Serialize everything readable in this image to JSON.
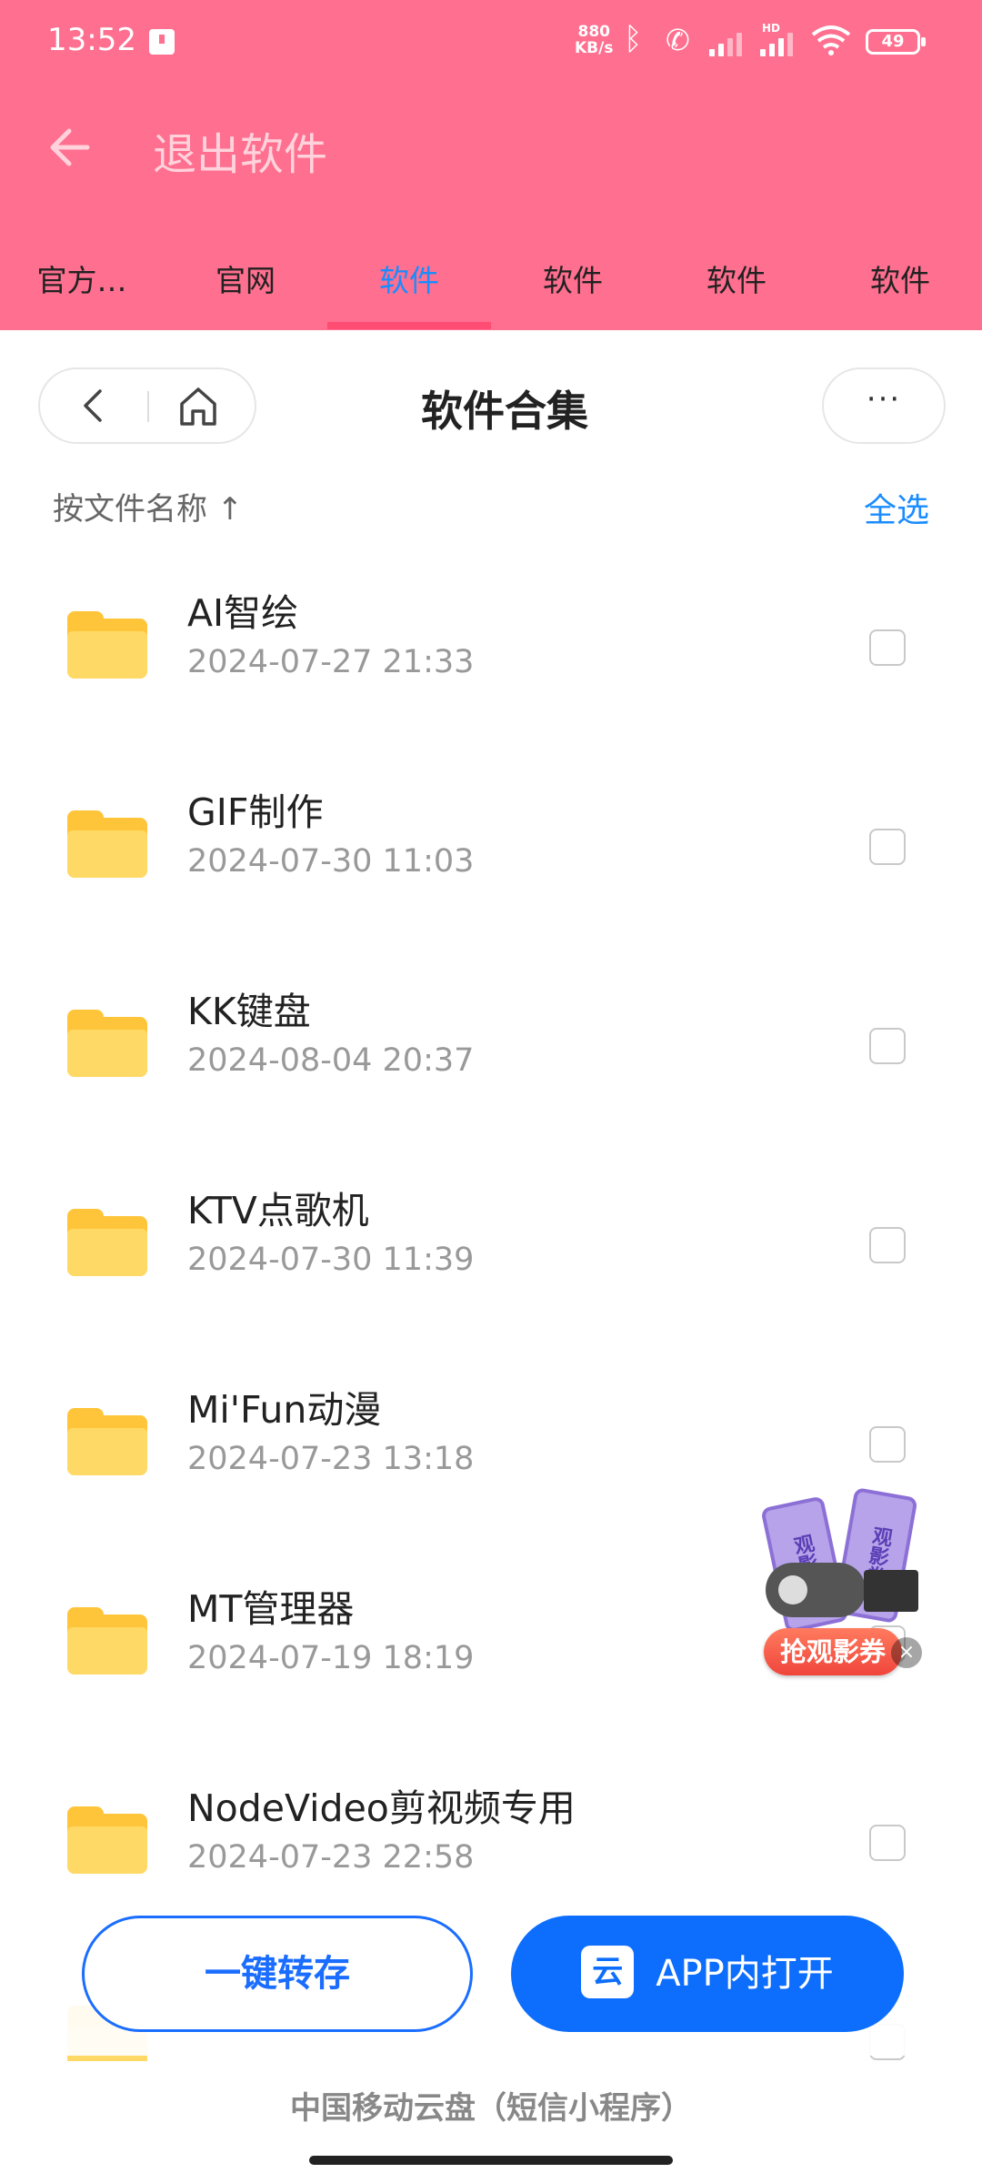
{
  "status_bar": {
    "time": "13:52",
    "speed_value": "880",
    "speed_unit": "KB/s",
    "signal_hd": "HD",
    "battery": "49"
  },
  "header": {
    "title": "退出软件",
    "tabs": [
      {
        "label": "官方…",
        "active": false
      },
      {
        "label": "官网",
        "active": false
      },
      {
        "label": "软件",
        "active": true
      },
      {
        "label": "软件",
        "active": false
      },
      {
        "label": "软件",
        "active": false
      },
      {
        "label": "软件",
        "active": false
      }
    ]
  },
  "toolbar": {
    "folder_title": "软件合集",
    "more_label": "···",
    "sort_label": "按文件名称 ↑",
    "select_all": "全选"
  },
  "files": [
    {
      "name": "AI智绘",
      "date": "2024-07-27 21:33"
    },
    {
      "name": "GIF制作",
      "date": "2024-07-30 11:03"
    },
    {
      "name": "KK键盘",
      "date": "2024-08-04 20:37"
    },
    {
      "name": "KTV点歌机",
      "date": "2024-07-30 11:39"
    },
    {
      "name": "Mi'Fun动漫",
      "date": "2024-07-23 13:18"
    },
    {
      "name": "MT管理器",
      "date": "2024-07-19 18:19"
    },
    {
      "name": "NodeVideo剪视频专用",
      "date": "2024-07-23 22:58"
    },
    {
      "name": "",
      "date": ""
    }
  ],
  "promo": {
    "ticket_text": "观影券",
    "button": "抢观影券",
    "close": "×"
  },
  "actions": {
    "save_label": "一键转存",
    "open_label": "APP内打开",
    "app_logo_glyph": "云"
  },
  "footer": {
    "text": "中国移动云盘（短信小程序）"
  },
  "colors": {
    "header_bg": "#ff6f8f",
    "accent_blue": "#1a8cff",
    "tab_underline": "#ff4c73",
    "folder_yellow": "#ffc53a"
  }
}
